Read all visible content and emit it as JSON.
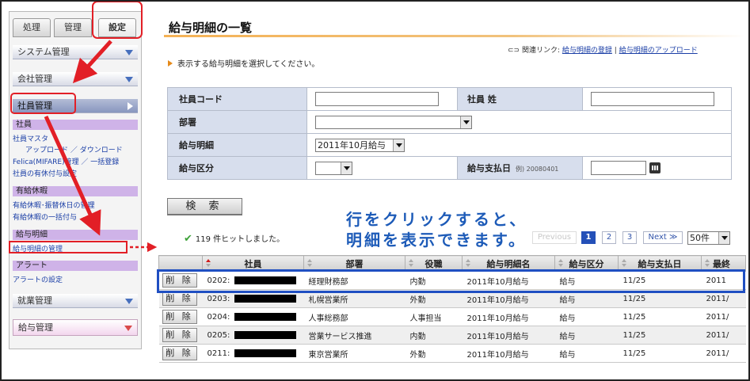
{
  "sidebar": {
    "tabs": [
      {
        "label": "処理"
      },
      {
        "label": "管理"
      },
      {
        "label": "設定"
      }
    ],
    "sections": {
      "system": "システム管理",
      "company": "会社管理",
      "employee": "社員管理",
      "work": "就業管理",
      "salary": "給与管理"
    },
    "groups": {
      "employee": "社員",
      "paid_leave": "有給休暇",
      "payslip": "給与明細",
      "alert": "アラート"
    },
    "links": {
      "employee_master": "社員マスタ",
      "upload_download": "アップロード ／ ダウンロード",
      "felica": "Felica(MIFARE)管理 ／ 一括登録",
      "leave_setting": "社員の有休付与設定",
      "leave_transfer": "有給休暇･振替休日の管理",
      "leave_bulk": "有給休暇の一括付与",
      "payslip_manage": "給与明細の管理",
      "alert_setting": "アラートの設定"
    }
  },
  "main": {
    "title": "給与明細の一覧",
    "related_prefix": "関連リンク:",
    "related_links": [
      "給与明細の登録",
      "給与明細のアップロード"
    ],
    "related_sep": "|",
    "instruction": "表示する給与明細を選択してください。",
    "form": {
      "employee_code_label": "社員コード",
      "last_name_label": "社員 姓",
      "department_label": "部署",
      "payslip_label": "給与明細",
      "payslip_value": "2011年10月給与",
      "salary_type_label": "給与区分",
      "pay_date_label": "給与支払日",
      "pay_date_example": "例) 20080401"
    },
    "search_button": "検 索",
    "overlay_line1": "行をクリックすると、",
    "overlay_line2": "明細を表示できます。",
    "hits_text": "119 件ヒットしました。",
    "pager": {
      "previous": "Previous",
      "pages": [
        "1",
        "2",
        "3"
      ],
      "next": "Next ≫",
      "per_page": "50件"
    },
    "table": {
      "headers": [
        "",
        "社員",
        "部署",
        "役職",
        "給与明細名",
        "給与区分",
        "給与支払日",
        "最終"
      ],
      "delete_label": "削 除",
      "rows": [
        {
          "code": "0202:",
          "dept": "経理財務部",
          "role": "内勤",
          "name": "2011年10月給与",
          "type": "給与",
          "date": "11/25",
          "last": "2011"
        },
        {
          "code": "0203:",
          "dept": "札幌営業所",
          "role": "外勤",
          "name": "2011年10月給与",
          "type": "給与",
          "date": "11/25",
          "last": "2011/"
        },
        {
          "code": "0204:",
          "dept": "人事総務部",
          "role": "人事担当",
          "name": "2011年10月給与",
          "type": "給与",
          "date": "11/25",
          "last": "2011/"
        },
        {
          "code": "0205:",
          "dept": "営業サービス推進",
          "role": "内勤",
          "name": "2011年10月給与",
          "type": "給与",
          "date": "11/25",
          "last": "2011/"
        },
        {
          "code": "0211:",
          "dept": "東京営業所",
          "role": "外勤",
          "name": "2011年10月給与",
          "type": "給与",
          "date": "11/25",
          "last": "2011/"
        }
      ]
    }
  },
  "colors": {
    "highlight_red": "#e21f26",
    "highlight_blue": "#1f4fc2",
    "overlay_text": "#1d5bb8"
  }
}
